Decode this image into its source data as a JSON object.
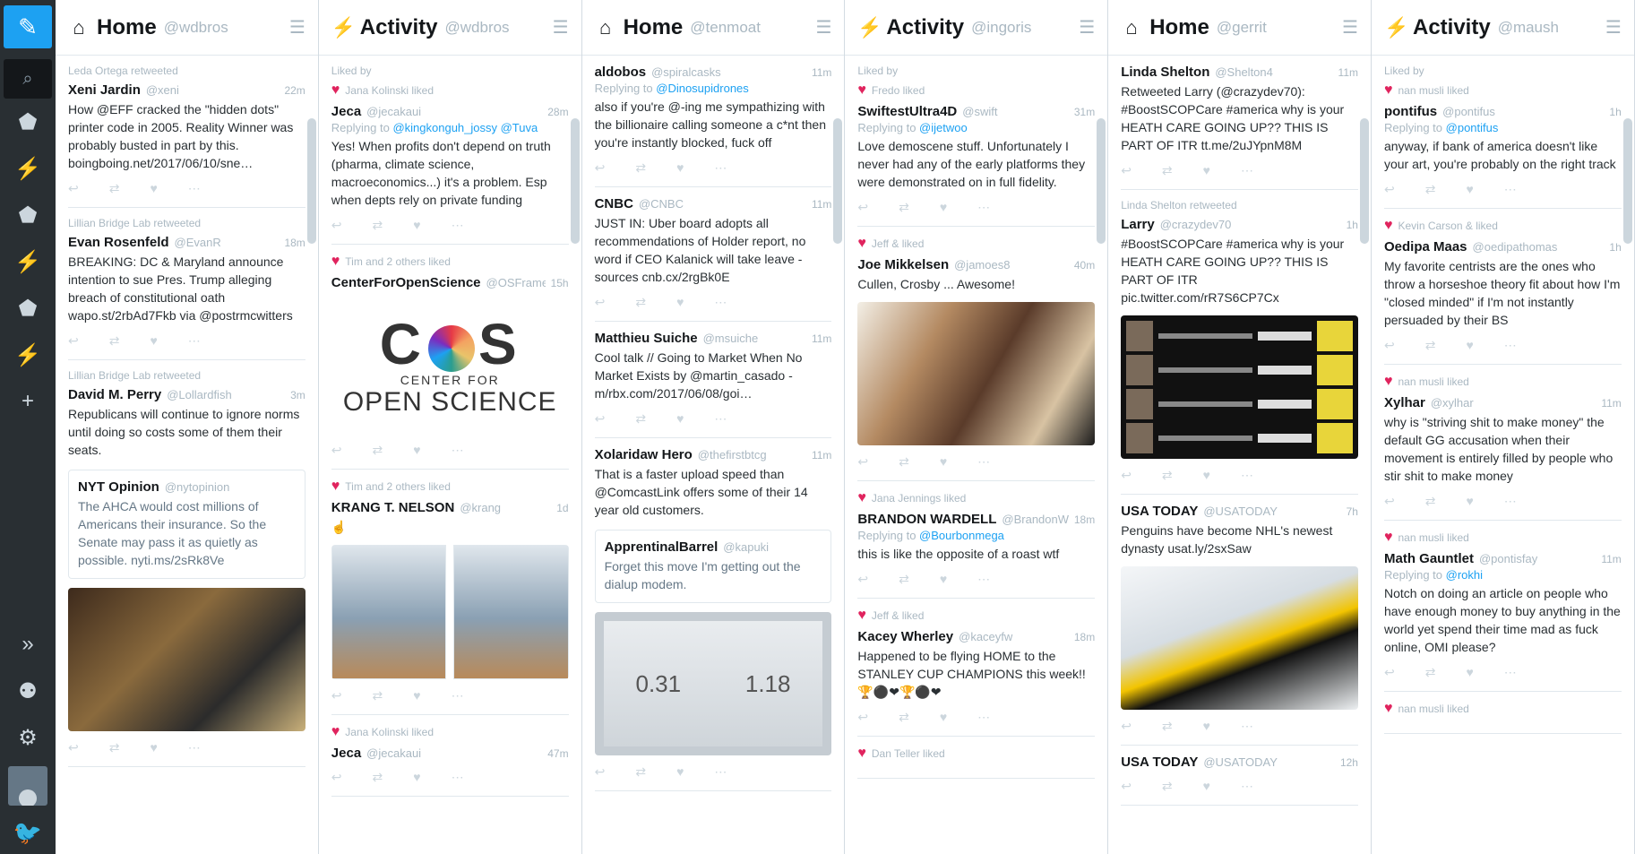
{
  "nav": {
    "items": [
      "compose-icon",
      "search-icon",
      "home-icon",
      "activity-icon",
      "home-icon",
      "activity-icon",
      "home-icon",
      "activity-icon",
      "add-column-icon"
    ],
    "bottom": [
      "expand-icon",
      "accounts-icon",
      "settings-icon"
    ]
  },
  "columns": [
    {
      "icon": "⌂",
      "title": "Home",
      "handle": "@wdbros",
      "tweets": [
        {
          "context": "Leda Ortega retweeted",
          "name": "Xeni Jardin",
          "handle": "@xeni",
          "time": "22m",
          "text": "How @EFF cracked the \"hidden dots\" printer code in 2005. Reality Winner was probably busted in part by this. boingboing.net/2017/06/10/sne…"
        },
        {
          "context": "Lillian Bridge Lab retweeted",
          "name": "Evan Rosenfeld",
          "handle": "@EvanR",
          "time": "18m",
          "text": "BREAKING: DC & Maryland announce intention to sue Pres. Trump alleging breach of constitutional oath wapo.st/2rbAd7Fkb via @postrmcwitters"
        },
        {
          "context": "Lillian Bridge Lab retweeted",
          "name": "David M. Perry",
          "handle": "@Lollardfish",
          "time": "3m",
          "text": "Republicans will continue to ignore norms until doing so costs some of them their seats.",
          "quote": {
            "name": "NYT Opinion",
            "handle": "@nytopinion",
            "text": "The AHCA would cost millions of Americans their insurance. So the Senate may pass it as quietly as possible. nyti.ms/2sRk8Ve"
          },
          "media": "photo"
        }
      ]
    },
    {
      "icon": "⚡",
      "title": "Activity",
      "handle": "@wdbros",
      "tweets": [
        {
          "context": "Liked by",
          "liker": "Jana Kolinski liked",
          "name": "Jeca",
          "handle": "@jecakaui",
          "time": "28m",
          "reply": "@kingkonguh_jossy @Tuva",
          "text": "Yes! When profits don't depend on truth (pharma, climate science, macroeconomics...) it's a problem. Esp when depts rely on private funding"
        },
        {
          "liker": "Tim and 2 others liked",
          "name": "CenterForOpenScience",
          "handle": "@OSFramework",
          "time": "15h",
          "text": "",
          "media": "cos"
        },
        {
          "liker": "Tim and 2 others liked",
          "name": "KRANG T. NELSON",
          "handle": "@krang",
          "time": "1d",
          "text": "☝",
          "media": "screens"
        },
        {
          "liker": "Jana Kolinski liked",
          "name": "Jeca",
          "handle": "@jecakaui",
          "time": "47m",
          "text": ""
        }
      ]
    },
    {
      "icon": "⌂",
      "title": "Home",
      "handle": "@tenmoat",
      "tweets": [
        {
          "name": "aldobos",
          "handle": "@spiralcasks",
          "time": "11m",
          "reply": "@Dinosupidrones",
          "text": "also if you're @-ing me sympathizing with the billionaire calling someone a c*nt then you're instantly blocked, fuck off"
        },
        {
          "name": "CNBC",
          "handle": "@CNBC",
          "time": "11m",
          "text": "JUST IN: Uber board adopts all recommendations of Holder report, no word if CEO Kalanick will take leave - sources cnb.cx/2rgBk0E"
        },
        {
          "name": "Matthieu Suiche",
          "handle": "@msuiche",
          "time": "11m",
          "text": "Cool talk // Going to Market When No Market Exists by @martin_casado - m/rbx.com/2017/06/08/goi…"
        },
        {
          "name": "Xolaridaw Hero",
          "handle": "@thefirstbtcg",
          "time": "11m",
          "text": "That is a faster upload speed than @ComcastLink offers some of their 14 year old customers.",
          "quote": {
            "name": "ApprentinalBarrel",
            "handle": "@kapuki",
            "text": "Forget this move I'm getting out the dialup modem."
          },
          "media": "screen2"
        }
      ]
    },
    {
      "icon": "⚡",
      "title": "Activity",
      "handle": "@ingoris",
      "tweets": [
        {
          "context": "Liked by",
          "liker": "Fredo liked",
          "name": "SwiftestUltra4D",
          "handle": "@swift",
          "time": "31m",
          "reply": "@ijetwoo",
          "text": "Love demoscene stuff. Unfortunately I never had any of the early platforms they were demonstrated on in full fidelity."
        },
        {
          "liker": "Jeff & liked",
          "name": "Joe Mikkelsen",
          "handle": "@jamoes8",
          "time": "40m",
          "text": "Cullen, Crosby ... Awesome!",
          "media": "hug"
        },
        {
          "liker": "Jana Jennings liked",
          "name": "BRANDON WARDELL",
          "handle": "@BrandonWardell",
          "time": "18m",
          "reply": "@Bourbonmega",
          "text": "this is like the opposite of a roast wtf"
        },
        {
          "liker": "Jeff & liked",
          "name": "Kacey Wherley",
          "handle": "@kaceyfw",
          "time": "18m",
          "text": "Happened to be flying HOME to the STANLEY CUP CHAMPIONS this week!! 🏆⚫❤🏆⚫❤"
        },
        {
          "liker": "Dan Teller liked",
          "name": "",
          "handle": "",
          "time": "",
          "text": ""
        }
      ]
    },
    {
      "icon": "⌂",
      "title": "Home",
      "handle": "@gerrit",
      "tweets": [
        {
          "name": "Linda Shelton",
          "handle": "@Shelton4",
          "time": "11m",
          "text": "Retweeted Larry (@crazydev70): #BoostSCOPCare #america why is your HEATH CARE GOING UP?? THIS IS PART OF ITR tt.me/2uJYpnM8M"
        },
        {
          "context": "Linda Shelton retweeted",
          "name": "Larry",
          "handle": "@crazydev70",
          "time": "1h",
          "text": "#BoostSCOPCare #america why is your HEATH CARE GOING UP?? THIS IS PART OF ITR pic.twitter.com/rR7S6CP7Cx",
          "media": "board"
        },
        {
          "name": "USA TODAY",
          "handle": "@USATODAY",
          "time": "7h",
          "text": "Penguins have become NHL's newest dynasty usat.ly/2sxSaw",
          "media": "hockey"
        },
        {
          "name": "USA TODAY",
          "handle": "@USATODAY",
          "time": "12h",
          "text": ""
        }
      ]
    },
    {
      "icon": "⚡",
      "title": "Activity",
      "handle": "@maush",
      "tweets": [
        {
          "context": "Liked by",
          "liker": "nan musli liked",
          "name": "pontifus",
          "handle": "@pontifus",
          "time": "1h",
          "reply": "@pontifus",
          "text": "anyway, if bank of america doesn't like your art, you're probably on the right track"
        },
        {
          "liker": "Kevin Carson & liked",
          "name": "Oedipa Maas",
          "handle": "@oedipathomas",
          "time": "1h",
          "text": "My favorite centrists are the ones who throw a horseshoe theory fit about how I'm \"closed minded\" if I'm not instantly persuaded by their BS"
        },
        {
          "liker": "nan musli liked",
          "name": "Xylhar",
          "handle": "@xylhar",
          "time": "11m",
          "text": "why is \"striving shit to make money\" the default GG accusation when their movement is entirely filled by people who stir shit to make money"
        },
        {
          "liker": "nan musli liked",
          "name": "Math Gauntlet",
          "handle": "@pontisfay",
          "time": "11m",
          "reply": "@rokhi",
          "text": "Notch on doing an article on people who have enough money to buy anything in the world yet spend their time mad as fuck online, OMI please?"
        },
        {
          "liker": "nan musli liked",
          "name": "",
          "handle": "",
          "time": "",
          "text": ""
        }
      ]
    }
  ],
  "actions": [
    "↩",
    "⇄",
    "♥",
    "⋯"
  ],
  "colors": {
    "accent": "#1da1f2",
    "nav": "#292f33",
    "like": "#e0245e"
  }
}
